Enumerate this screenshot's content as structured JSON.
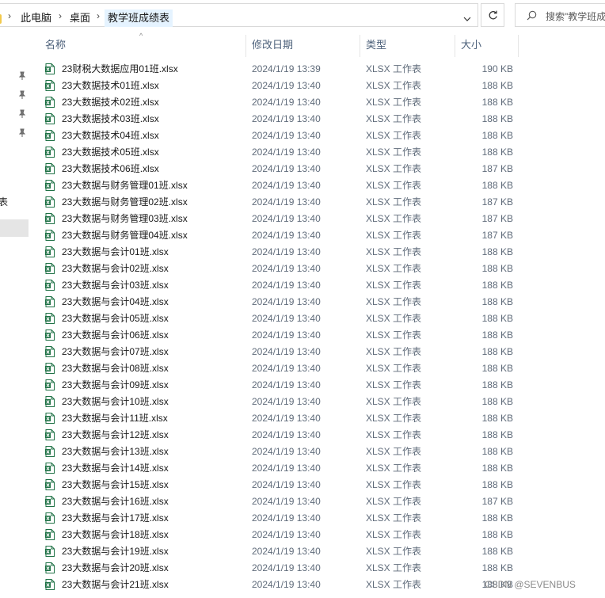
{
  "address_bar": {
    "breadcrumbs": [
      "此电脑",
      "桌面",
      "教学班成绩表"
    ]
  },
  "search": {
    "placeholder": "搜索\"教学班成"
  },
  "nav": {
    "fragment": "表"
  },
  "columns": {
    "name": "名称",
    "date": "修改日期",
    "type": "类型",
    "size": "大小"
  },
  "files": [
    {
      "name": "23财税大数据应用01班.xlsx",
      "date": "2024/1/19 13:39",
      "type": "XLSX 工作表",
      "size": "190 KB"
    },
    {
      "name": "23大数据技术01班.xlsx",
      "date": "2024/1/19 13:40",
      "type": "XLSX 工作表",
      "size": "188 KB"
    },
    {
      "name": "23大数据技术02班.xlsx",
      "date": "2024/1/19 13:40",
      "type": "XLSX 工作表",
      "size": "188 KB"
    },
    {
      "name": "23大数据技术03班.xlsx",
      "date": "2024/1/19 13:40",
      "type": "XLSX 工作表",
      "size": "188 KB"
    },
    {
      "name": "23大数据技术04班.xlsx",
      "date": "2024/1/19 13:40",
      "type": "XLSX 工作表",
      "size": "188 KB"
    },
    {
      "name": "23大数据技术05班.xlsx",
      "date": "2024/1/19 13:40",
      "type": "XLSX 工作表",
      "size": "188 KB"
    },
    {
      "name": "23大数据技术06班.xlsx",
      "date": "2024/1/19 13:40",
      "type": "XLSX 工作表",
      "size": "187 KB"
    },
    {
      "name": "23大数据与财务管理01班.xlsx",
      "date": "2024/1/19 13:40",
      "type": "XLSX 工作表",
      "size": "188 KB"
    },
    {
      "name": "23大数据与财务管理02班.xlsx",
      "date": "2024/1/19 13:40",
      "type": "XLSX 工作表",
      "size": "187 KB"
    },
    {
      "name": "23大数据与财务管理03班.xlsx",
      "date": "2024/1/19 13:40",
      "type": "XLSX 工作表",
      "size": "187 KB"
    },
    {
      "name": "23大数据与财务管理04班.xlsx",
      "date": "2024/1/19 13:40",
      "type": "XLSX 工作表",
      "size": "187 KB"
    },
    {
      "name": "23大数据与会计01班.xlsx",
      "date": "2024/1/19 13:40",
      "type": "XLSX 工作表",
      "size": "188 KB"
    },
    {
      "name": "23大数据与会计02班.xlsx",
      "date": "2024/1/19 13:40",
      "type": "XLSX 工作表",
      "size": "188 KB"
    },
    {
      "name": "23大数据与会计03班.xlsx",
      "date": "2024/1/19 13:40",
      "type": "XLSX 工作表",
      "size": "188 KB"
    },
    {
      "name": "23大数据与会计04班.xlsx",
      "date": "2024/1/19 13:40",
      "type": "XLSX 工作表",
      "size": "188 KB"
    },
    {
      "name": "23大数据与会计05班.xlsx",
      "date": "2024/1/19 13:40",
      "type": "XLSX 工作表",
      "size": "188 KB"
    },
    {
      "name": "23大数据与会计06班.xlsx",
      "date": "2024/1/19 13:40",
      "type": "XLSX 工作表",
      "size": "188 KB"
    },
    {
      "name": "23大数据与会计07班.xlsx",
      "date": "2024/1/19 13:40",
      "type": "XLSX 工作表",
      "size": "188 KB"
    },
    {
      "name": "23大数据与会计08班.xlsx",
      "date": "2024/1/19 13:40",
      "type": "XLSX 工作表",
      "size": "188 KB"
    },
    {
      "name": "23大数据与会计09班.xlsx",
      "date": "2024/1/19 13:40",
      "type": "XLSX 工作表",
      "size": "188 KB"
    },
    {
      "name": "23大数据与会计10班.xlsx",
      "date": "2024/1/19 13:40",
      "type": "XLSX 工作表",
      "size": "188 KB"
    },
    {
      "name": "23大数据与会计11班.xlsx",
      "date": "2024/1/19 13:40",
      "type": "XLSX 工作表",
      "size": "188 KB"
    },
    {
      "name": "23大数据与会计12班.xlsx",
      "date": "2024/1/19 13:40",
      "type": "XLSX 工作表",
      "size": "188 KB"
    },
    {
      "name": "23大数据与会计13班.xlsx",
      "date": "2024/1/19 13:40",
      "type": "XLSX 工作表",
      "size": "188 KB"
    },
    {
      "name": "23大数据与会计14班.xlsx",
      "date": "2024/1/19 13:40",
      "type": "XLSX 工作表",
      "size": "188 KB"
    },
    {
      "name": "23大数据与会计15班.xlsx",
      "date": "2024/1/19 13:40",
      "type": "XLSX 工作表",
      "size": "188 KB"
    },
    {
      "name": "23大数据与会计16班.xlsx",
      "date": "2024/1/19 13:40",
      "type": "XLSX 工作表",
      "size": "187 KB"
    },
    {
      "name": "23大数据与会计17班.xlsx",
      "date": "2024/1/19 13:40",
      "type": "XLSX 工作表",
      "size": "188 KB"
    },
    {
      "name": "23大数据与会计18班.xlsx",
      "date": "2024/1/19 13:40",
      "type": "XLSX 工作表",
      "size": "188 KB"
    },
    {
      "name": "23大数据与会计19班.xlsx",
      "date": "2024/1/19 13:40",
      "type": "XLSX 工作表",
      "size": "188 KB"
    },
    {
      "name": "23大数据与会计20班.xlsx",
      "date": "2024/1/19 13:40",
      "type": "XLSX 工作表",
      "size": "188 KB"
    },
    {
      "name": "23大数据与会计21班.xlsx",
      "date": "2024/1/19 13:40",
      "type": "XLSX 工作表",
      "size": "188 KB"
    }
  ],
  "watermark": "CSDN @SEVENBUS",
  "colors": {
    "excel_green": "#1e7145",
    "header_text": "#4c607a",
    "selected_crumb": "#e5f3ff"
  },
  "icons": {
    "file": "excel-file-icon",
    "pin": "pin-icon",
    "search": "search-icon",
    "refresh": "refresh-icon",
    "dropdown": "chevron-down-icon",
    "separator": "chevron-right-icon"
  }
}
